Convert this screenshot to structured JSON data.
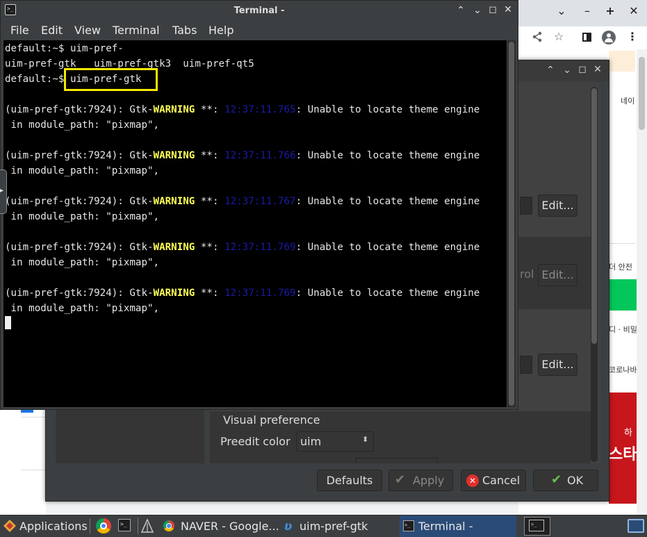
{
  "terminal": {
    "title": "Terminal -",
    "menu": [
      "File",
      "Edit",
      "View",
      "Terminal",
      "Tabs",
      "Help"
    ],
    "line1": "default:~$ uim-pref-",
    "line2": "uim-pref-gtk   uim-pref-gtk3  uim-pref-qt5",
    "line3_prompt": "default:~$ ",
    "line3_cmd": "uim-pref-gtk",
    "warn_prefix": "(uim-pref-gtk:7924): Gtk-",
    "warn_word": "WARNING",
    "warn_stars": " **: ",
    "warn_suffix": ": Unable to locate theme engine",
    "warn_cont": " in module_path: \"pixmap\",",
    "timestamps": [
      "12:37:11.765",
      "12:37:11.766",
      "12:37:11.767",
      "12:37:11.769",
      "12:37:11.769"
    ]
  },
  "dialog": {
    "edit_button": "Edit...",
    "ctrl_fragment": "rol",
    "visual_preference": "Visual preference",
    "preedit_color_label": "Preedit color",
    "preedit_color_value": "uim",
    "defaults_button": "Defaults",
    "apply_button": "Apply",
    "cancel_button": "Cancel",
    "ok_button": "OK"
  },
  "browser": {
    "frag1": "네이",
    "frag2": "더 안전",
    "frag3": "디 · 비밀",
    "frag4": "코로나바",
    "frag5": "하",
    "frag6": "스타"
  },
  "taskbar": {
    "applications": "Applications",
    "naver_task": "NAVER - Google...",
    "uim_task": "uim-pref-gtk",
    "terminal_task": "Terminal -"
  }
}
